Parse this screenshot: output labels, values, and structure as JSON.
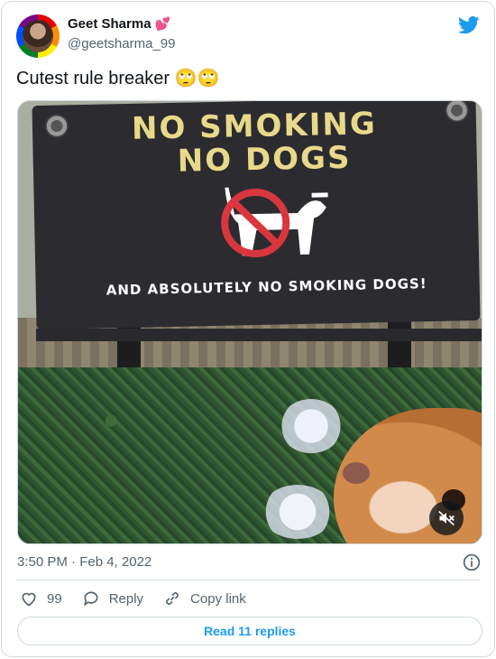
{
  "user": {
    "name": "Geet Sharma",
    "name_emoji": "💕",
    "handle": "@geetsharma_99"
  },
  "tweet": {
    "text": "Cutest rule breaker 🙄🙄"
  },
  "media": {
    "sign_line1": "NO SMOKING",
    "sign_line2": "NO DOGS",
    "sign_line3": "AND ABSOLUTELY NO SMOKING DOGS!"
  },
  "meta": {
    "timestamp": "3:50 PM · Feb 4, 2022"
  },
  "actions": {
    "like_count": "99",
    "reply_label": "Reply",
    "copy_label": "Copy link"
  },
  "footer": {
    "read_replies": "Read 11 replies"
  },
  "colors": {
    "brand": "#1d9bf0",
    "muted": "#536471",
    "border": "#cfd9de"
  },
  "icons": [
    "twitter-bird-icon",
    "mute-icon",
    "info-icon",
    "heart-icon",
    "reply-icon",
    "link-icon"
  ]
}
